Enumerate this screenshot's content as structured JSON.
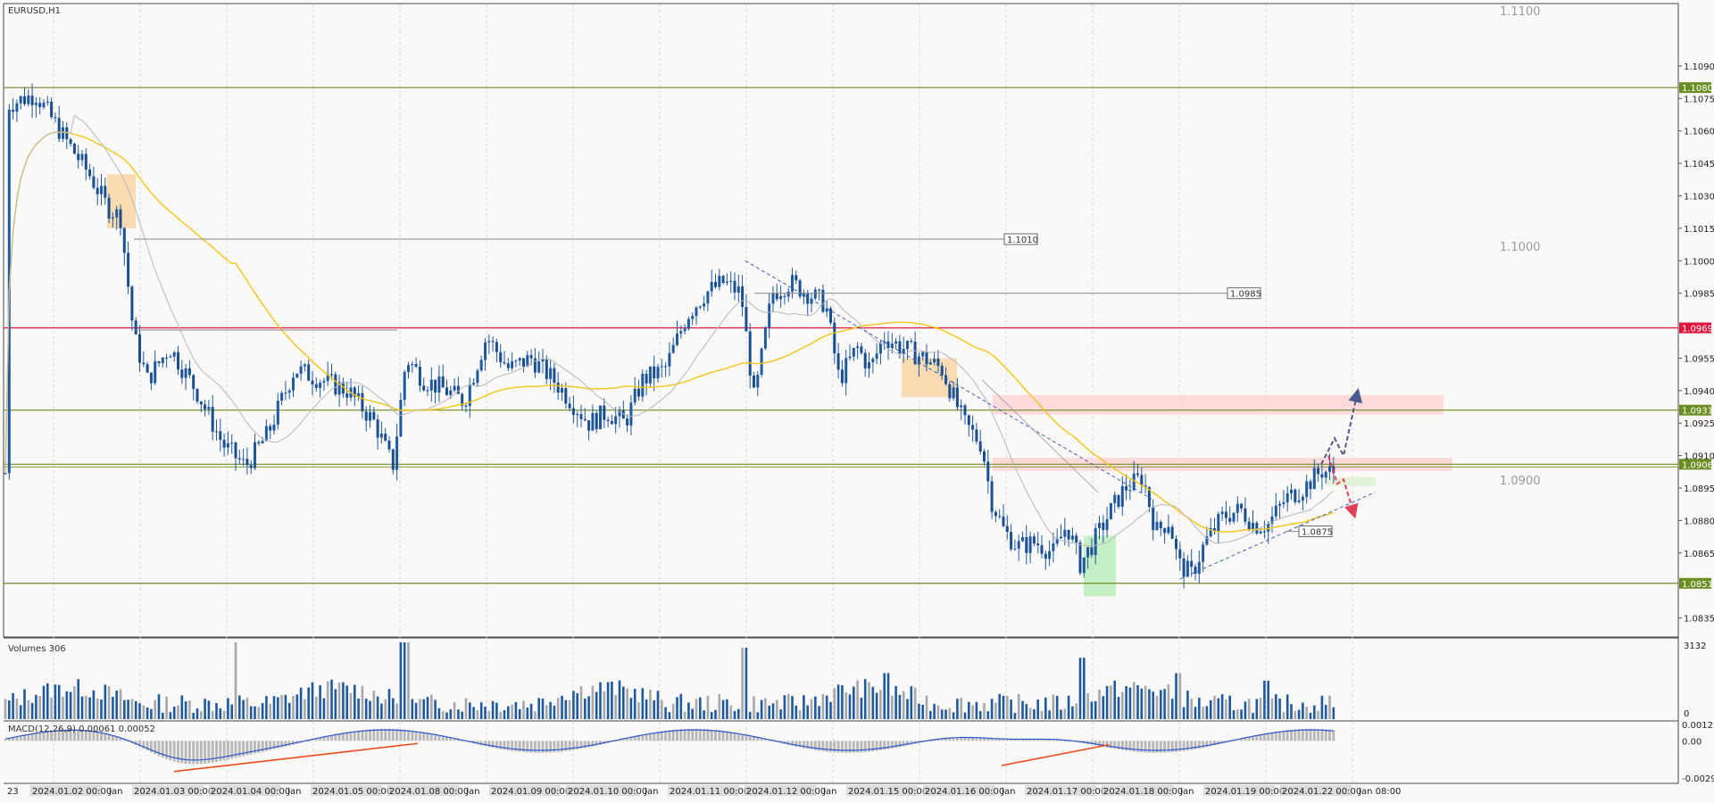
{
  "title": "EURUSD,H1",
  "volumes_label": "Volumes 306",
  "macd_label": "MACD(12,26,9) 0.00061 0.00052",
  "right_price_notes": [
    "1.1100",
    "1.1000",
    "1.0900"
  ],
  "chart_data": {
    "type": "candlestick",
    "symbol": "EURUSD",
    "timeframe": "H1",
    "price_range": [
      1.0827,
      1.1118
    ],
    "price_ticks": [
      "1.1090",
      "1.1075",
      "1.1060",
      "1.1045",
      "1.1030",
      "1.1015",
      "1.1000",
      "1.0985",
      "1.0955",
      "1.0940",
      "1.0925",
      "1.0910",
      "1.0895",
      "1.0880",
      "1.0865",
      "1.0835"
    ],
    "horizontal_levels": [
      {
        "price": 1.108,
        "label": "1.1080",
        "color": "#6b8e23"
      },
      {
        "price": 1.0969,
        "label": "1.0969",
        "color": "#e0143c"
      },
      {
        "price": 1.0931,
        "label": "1.0931",
        "color": "#6b8e23"
      },
      {
        "price": 1.0906,
        "label": "1.0906",
        "color": "#6b8e23"
      },
      {
        "price": 1.0851,
        "label": "1.0851",
        "color": "#6b8e23"
      }
    ],
    "line_callouts": [
      "1.1010",
      "1.0985",
      "1.0875"
    ],
    "time_labels": [
      "23",
      "2024.01.02 00:00",
      "Jan",
      "2024.01.03 00:00",
      "2024.01.04 00:00",
      "Jan",
      "2024.01.05 00:00",
      "2024.01.08 00:00",
      "Jan",
      "2024.01.09 00:00",
      "2024.01.10 00:00",
      "Jan",
      "2024.01.11 00:00",
      "2024.01.12 00:00",
      "Jan",
      "2024.01.15 00:00",
      "2024.01.16 00:00",
      "Jan",
      "2024.01.17 00:00",
      "2024.01.18 00:00",
      "Jan",
      "2024.01.19 00:00",
      "2024.01.22 00:00",
      "Jan 08:00"
    ],
    "volume_ticks": [
      "3132",
      "0"
    ],
    "macd_ticks": [
      "0.00122",
      "0.00",
      "-0.00292"
    ],
    "macd": {
      "value": 0.00061,
      "signal": 0.00052
    },
    "colors": {
      "up": "#1f5aa0",
      "down": "#1f5aa0",
      "ma_slow": "#f5c518",
      "ma_fast": "#b8b8b8",
      "macd_signal": "#2f56d0",
      "divergence": "#f04a1a"
    }
  }
}
